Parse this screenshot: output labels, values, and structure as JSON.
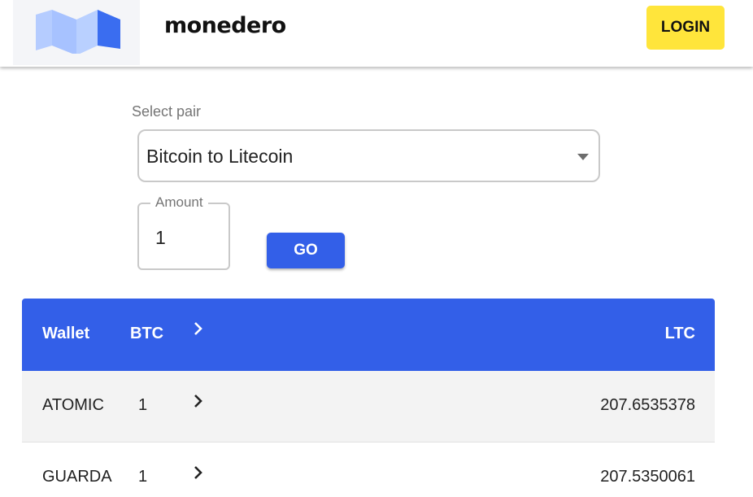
{
  "header": {
    "brand": "monedero",
    "login_label": "LOGIN",
    "logo_colors": {
      "light": "#a7c4ff",
      "dark": "#3a6df0"
    }
  },
  "form": {
    "pair_label": "Select pair",
    "pair_value": "Bitcoin to Litecoin",
    "amount_label": "Amount",
    "amount_value": "1",
    "go_label": "GO"
  },
  "table": {
    "headers": {
      "wallet": "Wallet",
      "from": "BTC",
      "to": "LTC"
    },
    "rows": [
      {
        "wallet": "ATOMIC",
        "amount": "1",
        "result": "207.6535378"
      },
      {
        "wallet": "GUARDA",
        "amount": "1",
        "result": "207.5350061"
      }
    ]
  },
  "colors": {
    "accent_blue": "#335fe8",
    "login_yellow": "#ffe53b",
    "row_alt": "#f3f3f3"
  }
}
